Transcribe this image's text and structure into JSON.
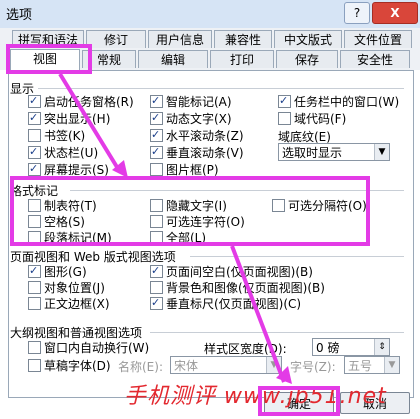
{
  "window": {
    "title": "选项",
    "help_glyph": "?",
    "close_glyph": "X"
  },
  "tabs_row1": [
    "拼写和语法",
    "修订",
    "用户信息",
    "兼容性",
    "中文版式",
    "文件位置"
  ],
  "tabs_row2": [
    "视图",
    "常规",
    "编辑",
    "打印",
    "保存",
    "安全性"
  ],
  "display": {
    "heading": "显示",
    "col1": [
      {
        "label": "启动任务窗格(R)",
        "checked": true
      },
      {
        "label": "突出显示(H)",
        "checked": true
      },
      {
        "label": "书签(K)",
        "checked": false
      },
      {
        "label": "状态栏(U)",
        "checked": true
      },
      {
        "label": "屏幕提示(S)",
        "checked": true
      }
    ],
    "col2": [
      {
        "label": "智能标记(A)",
        "checked": true
      },
      {
        "label": "动态文字(X)",
        "checked": true
      },
      {
        "label": "水平滚动条(Z)",
        "checked": true
      },
      {
        "label": "垂直滚动条(V)",
        "checked": true
      },
      {
        "label": "图片框(P)",
        "checked": false
      }
    ],
    "col3": [
      {
        "label": "任务栏中的窗口(W)",
        "checked": true
      },
      {
        "label": "域代码(F)",
        "checked": false
      }
    ],
    "shading_label": "域底纹(E)",
    "shading_value": "选取时显示"
  },
  "format": {
    "heading": "格式标记",
    "col1": [
      {
        "label": "制表符(T)",
        "checked": false
      },
      {
        "label": "空格(S)",
        "checked": false
      },
      {
        "label": "段落标记(M)",
        "checked": false
      }
    ],
    "col2": [
      {
        "label": "隐藏文字(I)",
        "checked": false
      },
      {
        "label": "可选连字符(O)",
        "checked": false
      },
      {
        "label": "全部(L)",
        "checked": false
      }
    ],
    "col3": [
      {
        "label": "可选分隔符(O)",
        "checked": false
      }
    ]
  },
  "pageview": {
    "heading": "页面视图和 Web 版式视图选项",
    "col1": [
      {
        "label": "图形(G)",
        "checked": true
      },
      {
        "label": "对象位置(J)",
        "checked": false
      },
      {
        "label": "正文边框(X)",
        "checked": false
      }
    ],
    "col2": [
      {
        "label": "页面间空白(仅页面视图)(B)",
        "checked": true
      },
      {
        "label": "背景色和图像(仅页面视图)(B)",
        "checked": false
      },
      {
        "label": "垂直标尺(仅页面视图)(C)",
        "checked": true
      }
    ]
  },
  "outline": {
    "heading": "大纲视图和普通视图选项",
    "wrap_label": "窗口内自动换行(W)",
    "wrap_checked": false,
    "style_width_label": "样式区宽度(D):",
    "style_width_value": "0 磅",
    "draft_label": "草稿字体(D)",
    "draft_checked": false,
    "name_label": "名称(E):",
    "name_value": "宋体",
    "size_label": "字号(Z):",
    "size_value": "五号"
  },
  "buttons": {
    "ok": "确定",
    "cancel": "取消"
  },
  "watermark": "手机测评 www.jb51.net"
}
